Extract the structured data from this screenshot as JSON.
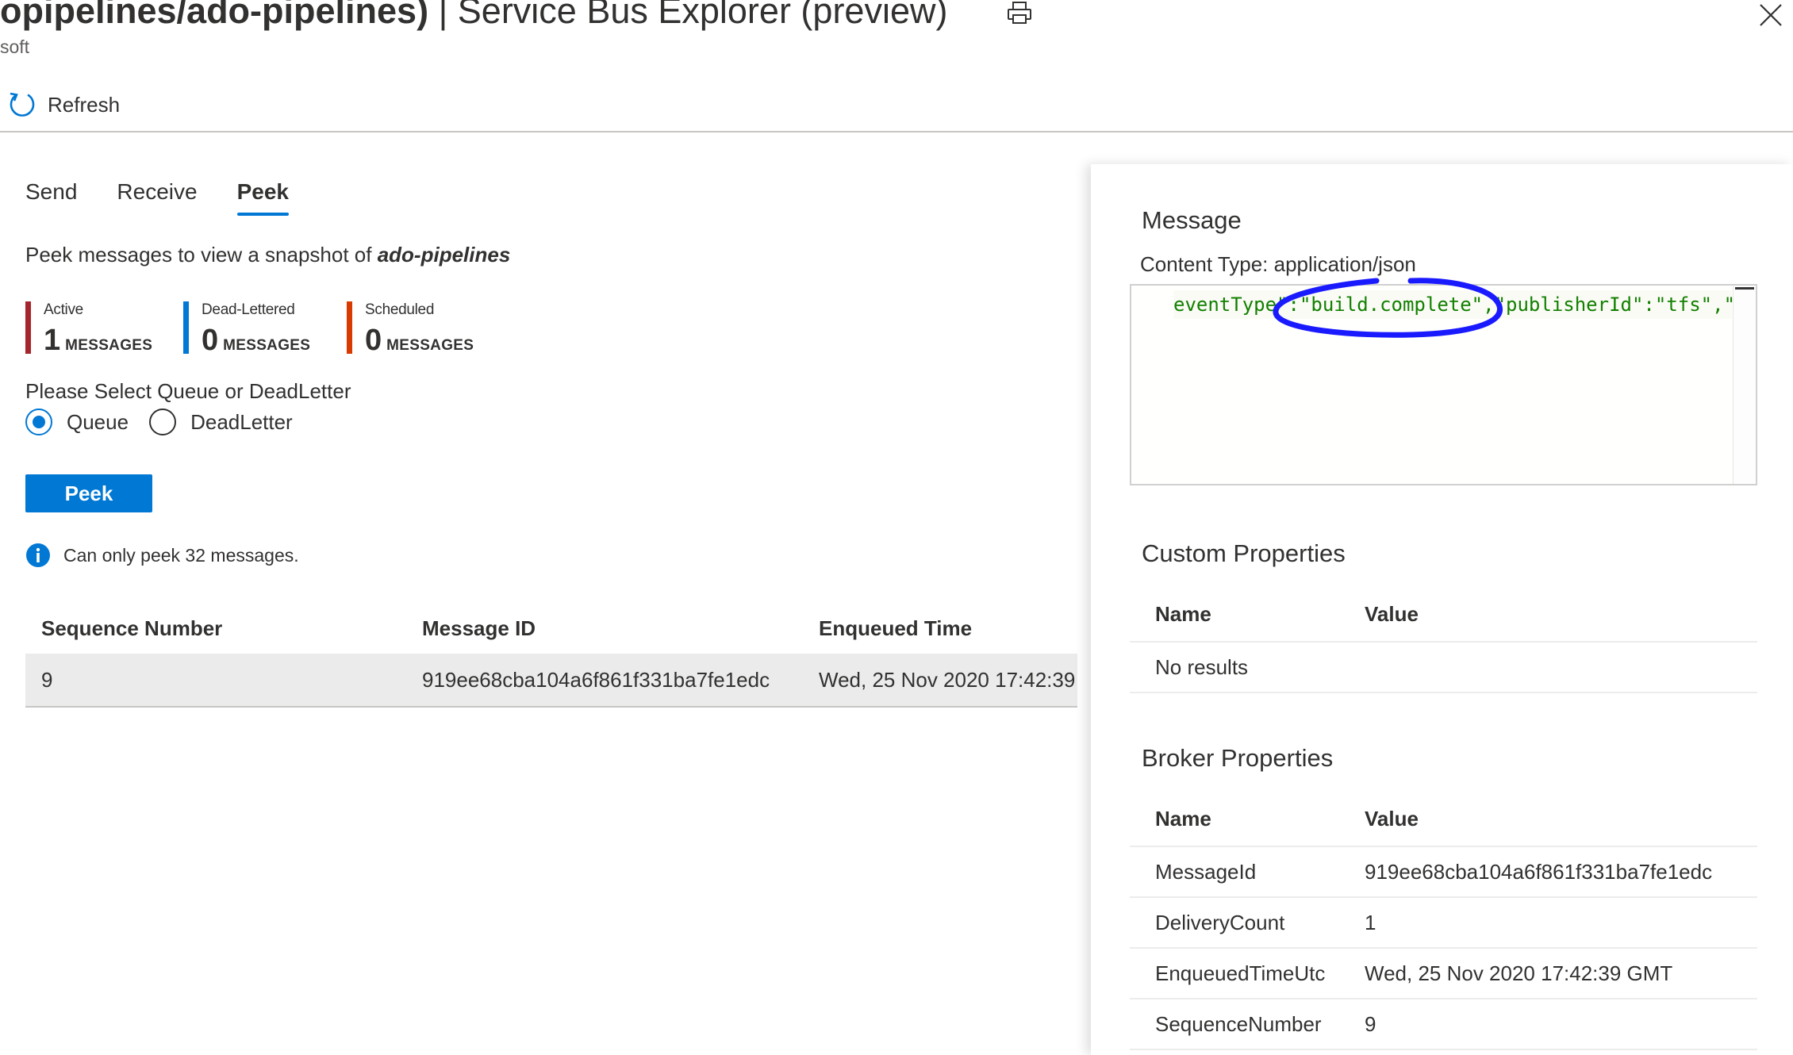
{
  "header": {
    "title_bold": "opipelines/ado-pipelines)",
    "title_rest": " | Service Bus Explorer (preview)",
    "subtitle": "soft",
    "print_icon": "print-icon",
    "close_icon": "close-icon"
  },
  "toolbar": {
    "refresh_label": "Refresh",
    "refresh_icon": "refresh-icon"
  },
  "tabs": [
    {
      "label": "Send",
      "active": false
    },
    {
      "label": "Receive",
      "active": false
    },
    {
      "label": "Peek",
      "active": true
    }
  ],
  "peek": {
    "description": "Peek messages to view a snapshot of ",
    "entity_name": "ado-pipelines",
    "counters": [
      {
        "label": "Active",
        "value": "1",
        "unit": "MESSAGES",
        "color": "#a4262c"
      },
      {
        "label": "Dead-Lettered",
        "value": "0",
        "unit": "MESSAGES",
        "color": "#0078d4"
      },
      {
        "label": "Scheduled",
        "value": "0",
        "unit": "MESSAGES",
        "color": "#d83b01"
      }
    ],
    "select_label": "Please Select Queue or DeadLetter",
    "radio_options": [
      {
        "label": "Queue",
        "checked": true
      },
      {
        "label": "DeadLetter",
        "checked": false
      }
    ],
    "button_label": "Peek",
    "info_text": "Can only peek 32 messages."
  },
  "messages_table": {
    "columns": [
      "Sequence Number",
      "Message ID",
      "Enqueued Time"
    ],
    "rows": [
      [
        "9",
        "919ee68cba104a6f861f331ba7fe1edc",
        "Wed, 25 Nov 2020 17:42:39"
      ]
    ]
  },
  "message_panel": {
    "title": "Message",
    "content_type": "Content Type: application/json",
    "body_visible": "eventType\":\"build.complete\",\"publisherId\":\"tfs\",\"me",
    "custom_properties": {
      "title": "Custom Properties",
      "columns": [
        "Name",
        "Value"
      ],
      "empty_text": "No results"
    },
    "broker_properties": {
      "title": "Broker Properties",
      "columns": [
        "Name",
        "Value"
      ],
      "rows": [
        [
          "MessageId",
          "919ee68cba104a6f861f331ba7fe1edc"
        ],
        [
          "DeliveryCount",
          "1"
        ],
        [
          "EnqueuedTimeUtc",
          "Wed, 25 Nov 2020 17:42:39 GMT"
        ],
        [
          "SequenceNumber",
          "9"
        ]
      ]
    }
  },
  "colors": {
    "accent": "#0078d4",
    "annotation": "#1a1aff",
    "code": "#118000"
  }
}
